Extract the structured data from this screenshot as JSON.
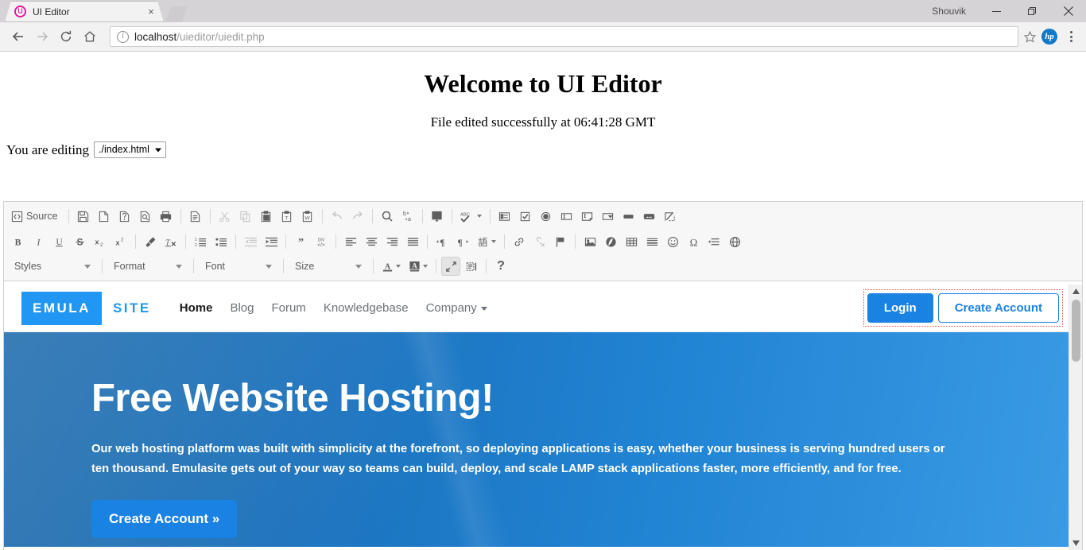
{
  "browser": {
    "tab": {
      "title": "UI Editor",
      "favicon": "ui-editor-favicon",
      "close": "×"
    },
    "profile_name": "Shouvik",
    "window_controls": {
      "minimize": "minimize",
      "restore": "restore",
      "close": "close"
    },
    "url_secure_part": "localhost",
    "url_rest": "/uieditor/uiedit.php",
    "url_full": "localhost/uieditor/uiedit.php",
    "bookmark": "star-icon",
    "extension": "hp",
    "menu": "chrome-menu"
  },
  "page": {
    "title": "Welcome to UI Editor",
    "status": "File edited successfully at 06:41:28 GMT",
    "editing_label": "You are editing",
    "editing_file": "./index.html"
  },
  "editor": {
    "row1": [
      {
        "name": "source",
        "label": "Source",
        "icon": "source-icon",
        "disabled": false
      },
      {
        "sep": true
      },
      {
        "name": "save",
        "label": "Save",
        "icon": "save-icon",
        "disabled": false
      },
      {
        "name": "new-page",
        "label": "New Page",
        "icon": "new-page-icon",
        "disabled": false
      },
      {
        "name": "templates",
        "label": "Templates",
        "icon": "templates-icon",
        "disabled": false
      },
      {
        "name": "preview",
        "label": "Preview",
        "icon": "preview-icon",
        "disabled": false
      },
      {
        "name": "print",
        "label": "Print",
        "icon": "print-icon",
        "disabled": false
      },
      {
        "sep": true
      },
      {
        "name": "document-properties",
        "label": "Document Properties",
        "icon": "document-properties-icon",
        "disabled": false
      },
      {
        "sep": true
      },
      {
        "name": "cut",
        "label": "Cut",
        "icon": "cut-icon",
        "disabled": true
      },
      {
        "name": "copy",
        "label": "Copy",
        "icon": "copy-icon",
        "disabled": true
      },
      {
        "name": "paste",
        "label": "Paste",
        "icon": "paste-icon",
        "disabled": false
      },
      {
        "name": "paste-as-plain-text",
        "label": "Paste as plain text",
        "icon": "paste-text-icon",
        "disabled": false
      },
      {
        "name": "paste-from-word",
        "label": "Paste from Word",
        "icon": "paste-word-icon",
        "disabled": false
      },
      {
        "sep": true
      },
      {
        "name": "undo",
        "label": "Undo",
        "icon": "undo-icon",
        "disabled": true
      },
      {
        "name": "redo",
        "label": "Redo",
        "icon": "redo-icon",
        "disabled": true
      },
      {
        "sep": true
      },
      {
        "name": "find",
        "label": "Find",
        "icon": "find-icon",
        "disabled": false
      },
      {
        "name": "replace",
        "label": "Replace",
        "icon": "replace-icon",
        "disabled": false
      },
      {
        "sep": true
      },
      {
        "name": "select-all",
        "label": "Select All",
        "icon": "select-all-icon",
        "disabled": false
      },
      {
        "sep": true
      },
      {
        "name": "spell-check",
        "label": "Spell Check As You Type",
        "icon": "spellcheck-icon",
        "dropdown": true,
        "disabled": false
      },
      {
        "sep": true
      },
      {
        "name": "form",
        "label": "Form",
        "icon": "form-icon",
        "disabled": false
      },
      {
        "name": "checkbox",
        "label": "Checkbox",
        "icon": "checkbox-icon",
        "disabled": false
      },
      {
        "name": "radio-button",
        "label": "Radio Button",
        "icon": "radio-icon",
        "disabled": false
      },
      {
        "name": "text-field",
        "label": "Text Field",
        "icon": "text-field-icon",
        "disabled": false
      },
      {
        "name": "textarea",
        "label": "Textarea",
        "icon": "textarea-icon",
        "disabled": false
      },
      {
        "name": "selection-field",
        "label": "Selection Field",
        "icon": "select-field-icon",
        "disabled": false
      },
      {
        "name": "button",
        "label": "Button",
        "icon": "button-icon",
        "disabled": false
      },
      {
        "name": "image-button",
        "label": "Image Button",
        "icon": "image-button-icon",
        "disabled": false
      },
      {
        "name": "hidden-field",
        "label": "Hidden Field",
        "icon": "hidden-field-icon",
        "disabled": false
      }
    ],
    "row2": [
      {
        "name": "bold",
        "label": "Bold",
        "icon": "bold-icon",
        "disabled": false
      },
      {
        "name": "italic",
        "label": "Italic",
        "icon": "italic-icon",
        "disabled": false
      },
      {
        "name": "underline",
        "label": "Underline",
        "icon": "underline-icon",
        "disabled": false
      },
      {
        "name": "strikethrough",
        "label": "Strikethrough",
        "icon": "strikethrough-icon",
        "disabled": false
      },
      {
        "name": "subscript",
        "label": "Subscript",
        "icon": "subscript-icon",
        "disabled": false
      },
      {
        "name": "superscript",
        "label": "Superscript",
        "icon": "superscript-icon",
        "disabled": false
      },
      {
        "sep": true
      },
      {
        "name": "copy-formatting",
        "label": "Copy Formatting",
        "icon": "brush-icon",
        "disabled": false
      },
      {
        "name": "remove-format",
        "label": "Remove Format",
        "icon": "remove-format-icon",
        "disabled": false
      },
      {
        "sep": true
      },
      {
        "name": "numbered-list",
        "label": "Insert/Remove Numbered List",
        "icon": "numbered-list-icon",
        "disabled": false
      },
      {
        "name": "bulleted-list",
        "label": "Insert/Remove Bulleted List",
        "icon": "bulleted-list-icon",
        "disabled": false
      },
      {
        "sep": true
      },
      {
        "name": "decrease-indent",
        "label": "Decrease Indent",
        "icon": "outdent-icon",
        "disabled": true
      },
      {
        "name": "increase-indent",
        "label": "Increase Indent",
        "icon": "indent-icon",
        "disabled": false
      },
      {
        "sep": true
      },
      {
        "name": "block-quote",
        "label": "Block Quote",
        "icon": "blockquote-icon",
        "disabled": false
      },
      {
        "name": "create-div",
        "label": "Create Div Container",
        "icon": "div-icon",
        "disabled": false
      },
      {
        "sep": true
      },
      {
        "name": "align-left",
        "label": "Align Left",
        "icon": "align-left-icon",
        "disabled": false
      },
      {
        "name": "center",
        "label": "Center",
        "icon": "align-center-icon",
        "disabled": false
      },
      {
        "name": "align-right",
        "label": "Align Right",
        "icon": "align-right-icon",
        "disabled": false
      },
      {
        "name": "justify",
        "label": "Justify",
        "icon": "align-justify-icon",
        "disabled": false
      },
      {
        "sep": true
      },
      {
        "name": "text-direction-ltr",
        "label": "Text direction from left to right",
        "icon": "ltr-icon",
        "disabled": false
      },
      {
        "name": "text-direction-rtl",
        "label": "Text direction from right to left",
        "icon": "rtl-icon",
        "disabled": false
      },
      {
        "name": "language",
        "label": "Set language",
        "icon": "language-icon",
        "dropdown": true,
        "disabled": false
      },
      {
        "sep": true
      },
      {
        "name": "link",
        "label": "Link",
        "icon": "link-icon",
        "disabled": false
      },
      {
        "name": "unlink",
        "label": "Unlink",
        "icon": "unlink-icon",
        "disabled": true
      },
      {
        "name": "anchor",
        "label": "Anchor",
        "icon": "anchor-flag-icon",
        "disabled": false
      },
      {
        "sep": true
      },
      {
        "name": "image",
        "label": "Image",
        "icon": "image-icon",
        "disabled": false
      },
      {
        "name": "flash",
        "label": "Flash",
        "icon": "flash-icon",
        "disabled": false
      },
      {
        "name": "table",
        "label": "Table",
        "icon": "table-icon",
        "disabled": false
      },
      {
        "name": "horizontal-line",
        "label": "Insert Horizontal Line",
        "icon": "horizontal-rule-icon",
        "disabled": false
      },
      {
        "name": "smiley",
        "label": "Smiley",
        "icon": "smiley-icon",
        "disabled": false
      },
      {
        "name": "special-character",
        "label": "Insert Special Character",
        "icon": "omega-icon",
        "disabled": false
      },
      {
        "name": "page-break",
        "label": "Page Break for Printing",
        "icon": "page-break-icon",
        "disabled": false
      },
      {
        "name": "iframe",
        "label": "IFrame",
        "icon": "iframe-globe-icon",
        "disabled": false
      }
    ],
    "row3": {
      "combos": [
        {
          "name": "styles",
          "label": "Styles"
        },
        {
          "name": "format",
          "label": "Format"
        },
        {
          "name": "font",
          "label": "Font"
        },
        {
          "name": "size",
          "label": "Size"
        }
      ],
      "buttons": [
        {
          "name": "text-color",
          "label": "Text Color",
          "icon": "text-color-icon",
          "dropdown": true,
          "active": false
        },
        {
          "name": "background-color",
          "label": "Background Color",
          "icon": "background-color-icon",
          "dropdown": true,
          "active": false
        },
        {
          "name": "maximize",
          "label": "Maximize",
          "icon": "maximize-icon",
          "active": true
        },
        {
          "name": "show-blocks",
          "label": "Show Blocks",
          "icon": "show-blocks-icon",
          "active": false
        },
        {
          "name": "about",
          "label": "About CKEditor",
          "icon": "question-mark-icon",
          "active": false
        }
      ]
    }
  },
  "site": {
    "logo_part1": "EMULA",
    "logo_part2": "SITE",
    "nav": [
      {
        "label": "Home",
        "current": true
      },
      {
        "label": "Blog",
        "current": false
      },
      {
        "label": "Forum",
        "current": false
      },
      {
        "label": "Knowledgebase",
        "current": false
      },
      {
        "label": "Company",
        "current": false,
        "dropdown": true
      }
    ],
    "login_label": "Login",
    "create_account_label": "Create Account",
    "hero": {
      "heading": "Free Website Hosting!",
      "paragraph": "Our web hosting platform was built with simplicity at the forefront, so deploying applications is easy, whether your business is serving hundred users or ten thousand. Emulasite gets out of your way so teams can build, deploy, and scale LAMP stack applications faster, more efficiently, and for free.",
      "cta_label": "Create Account »"
    }
  },
  "colors": {
    "brand_blue": "#2196f3",
    "button_blue": "#1a82e2",
    "hero_gradient_start": "#1565a8",
    "hero_gradient_end": "#3a9ae4",
    "selection_outline": "#d9534f",
    "favicon_pink": "#e6179b"
  }
}
